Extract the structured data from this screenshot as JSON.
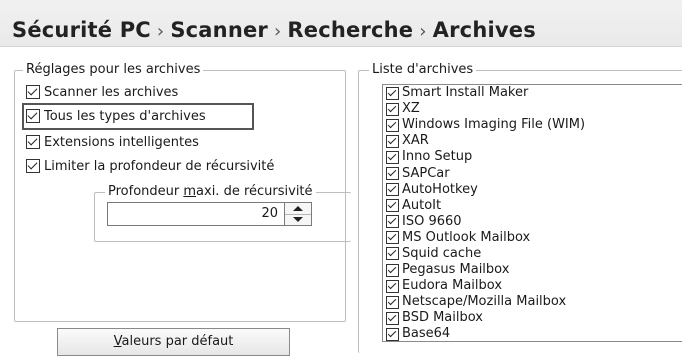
{
  "breadcrumb": {
    "items": [
      "Sécurité PC",
      "Scanner",
      "Recherche",
      "Archives"
    ],
    "separator": "›"
  },
  "settings_group": {
    "legend": "Réglages pour les archives",
    "options": [
      {
        "label": "Scanner les archives",
        "checked": true
      },
      {
        "label": "Tous les types d'archives",
        "checked": true
      },
      {
        "label": "Extensions intelligentes",
        "checked": true
      },
      {
        "label": "Limiter la profondeur de récursivité",
        "checked": true
      }
    ],
    "depth_group": {
      "legend_prefix": "Profondeur ",
      "legend_mnemonic": "m",
      "legend_suffix": "axi. de récursivité",
      "value": "20"
    },
    "defaults_button": {
      "mnemonic": "V",
      "label_rest": "aleurs par défaut"
    }
  },
  "archive_list": {
    "legend": "Liste d'archives",
    "items": [
      "Smart Install Maker",
      "XZ",
      "Windows Imaging File (WIM)",
      "XAR",
      "Inno Setup",
      "SAPCar",
      "AutoHotkey",
      "AutoIt",
      "ISO 9660",
      "MS Outlook Mailbox",
      "Squid cache",
      "Pegasus Mailbox",
      "Eudora Mailbox",
      "Netscape/Mozilla Mailbox",
      "BSD Mailbox",
      "Base64"
    ]
  },
  "colors": {
    "title_bar": "#ececec",
    "border": "#bdbdbd",
    "text": "#1a1a1a"
  }
}
